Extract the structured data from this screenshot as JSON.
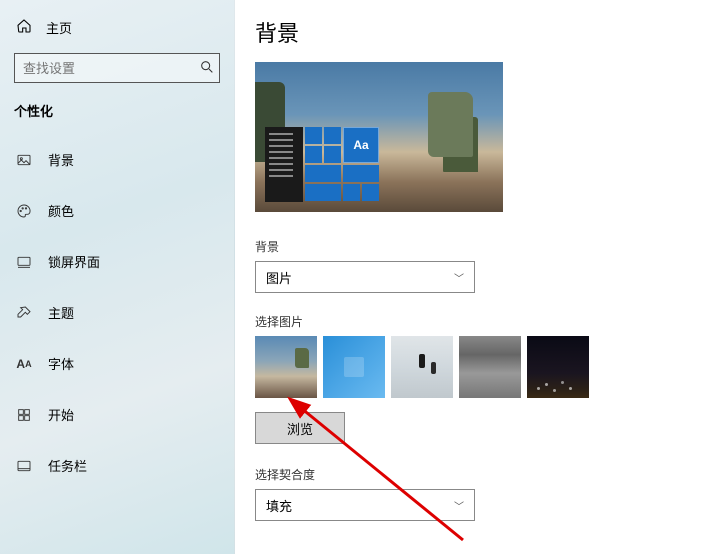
{
  "sidebar": {
    "home_label": "主页",
    "search_placeholder": "查找设置",
    "category_label": "个性化",
    "items": [
      {
        "label": "背景",
        "icon": "image-icon"
      },
      {
        "label": "颜色",
        "icon": "palette-icon"
      },
      {
        "label": "锁屏界面",
        "icon": "lock-screen-icon"
      },
      {
        "label": "主题",
        "icon": "theme-icon"
      },
      {
        "label": "字体",
        "icon": "font-icon"
      },
      {
        "label": "开始",
        "icon": "start-icon"
      },
      {
        "label": "任务栏",
        "icon": "taskbar-icon"
      }
    ]
  },
  "main": {
    "title": "背景",
    "preview_tile_text": "Aa",
    "background_label": "背景",
    "background_value": "图片",
    "choose_picture_label": "选择图片",
    "browse_label": "浏览",
    "fit_label": "选择契合度",
    "fit_value": "填充"
  }
}
